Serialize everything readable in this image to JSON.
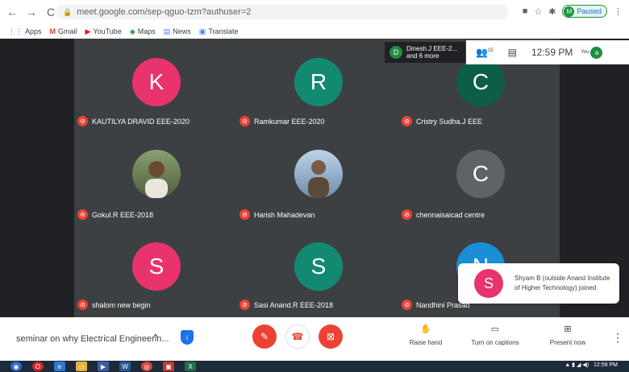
{
  "browser": {
    "url": "meet.google.com/sep-qguo-tzm?authuser=2",
    "profile_initial": "M",
    "profile_status": "Paused",
    "bookmarks": [
      {
        "label": "Apps",
        "icon": "apps-grid-icon"
      },
      {
        "label": "Gmail",
        "icon": "gmail-icon"
      },
      {
        "label": "YouTube",
        "icon": "youtube-icon"
      },
      {
        "label": "Maps",
        "icon": "maps-icon"
      },
      {
        "label": "News",
        "icon": "news-icon"
      },
      {
        "label": "Translate",
        "icon": "translate-icon"
      }
    ]
  },
  "meet": {
    "presenter": {
      "initial": "D",
      "line1": "Dinesh.J EEE-2...",
      "line2": "and 6 more"
    },
    "participants_count": "15",
    "time": "12:59 PM",
    "you_label": "You",
    "you_initial": "a",
    "tiles": [
      {
        "name": "KAUTILYA DRAVID EEE-2020",
        "initial": "K",
        "color": "#e8336d"
      },
      {
        "name": "Ramkumar EEE-2020",
        "initial": "R",
        "color": "#128a72"
      },
      {
        "name": "Cristry Sudha.J EEE",
        "initial": "C",
        "color": "#0d5e48"
      },
      {
        "name": "Gokul.R EEE-2018",
        "initial": "",
        "color": "#7a8b5c"
      },
      {
        "name": "Harish Mahadevan",
        "initial": "",
        "color": "#7fa7c9"
      },
      {
        "name": "chennaisaicad centre",
        "initial": "C",
        "color": "#5f6368"
      },
      {
        "name": "shalom new begin",
        "initial": "S",
        "color": "#e8336d"
      },
      {
        "name": "Sasi Anand.R EEE-2018",
        "initial": "S",
        "color": "#128a72"
      },
      {
        "name": "Nandhini Prasad",
        "initial": "N",
        "color": "#1a8fd6"
      }
    ],
    "toast": {
      "initial": "S",
      "message": "Shyam B (outside Anand Institute of Higher Technology) joined"
    },
    "meeting_title": "seminar on why Electrical Engineerin...",
    "actions": {
      "raise_hand": "Raise hand",
      "captions": "Turn on captions",
      "present": "Present now"
    }
  },
  "taskbar": {
    "time": "12:59 PM"
  }
}
